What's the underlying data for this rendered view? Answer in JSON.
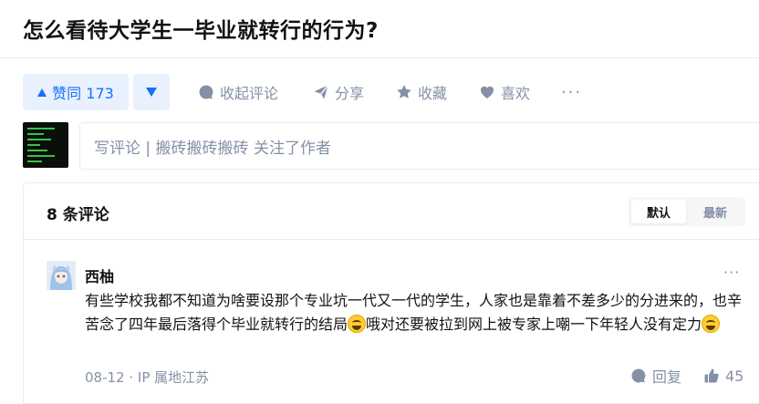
{
  "question": {
    "title": "怎么看待大学生一毕业就转行的行为?"
  },
  "actions": {
    "upvote_label": "赞同 173",
    "collapse_comments": "收起评论",
    "share": "分享",
    "favorite": "收藏",
    "like": "喜欢",
    "more": "···"
  },
  "composer": {
    "placeholder": "写评论 | 搬砖搬砖搬砖 关注了作者"
  },
  "comments": {
    "count_label": "8 条评论",
    "sort": {
      "default": "默认",
      "latest": "最新",
      "active": "默认"
    },
    "items": [
      {
        "author": "西柚",
        "more": "···",
        "text_part1": "有些学校我都不知道为啥要设那个专业坑一代又一代的学生，人家也是靠着不差多少的分进来的，也辛苦念了四年最后落得个毕业就转行的结局",
        "text_part2": "哦对还要被拉到网上被专家上嘲一下年轻人没有定力",
        "meta": "08-12 · IP 属地江苏",
        "reply_label": "回复",
        "likes": "45"
      }
    ]
  },
  "colors": {
    "accent": "#1772f6",
    "accent_bg": "#e8f1fd",
    "muted": "#8590a6",
    "text": "#121212"
  }
}
